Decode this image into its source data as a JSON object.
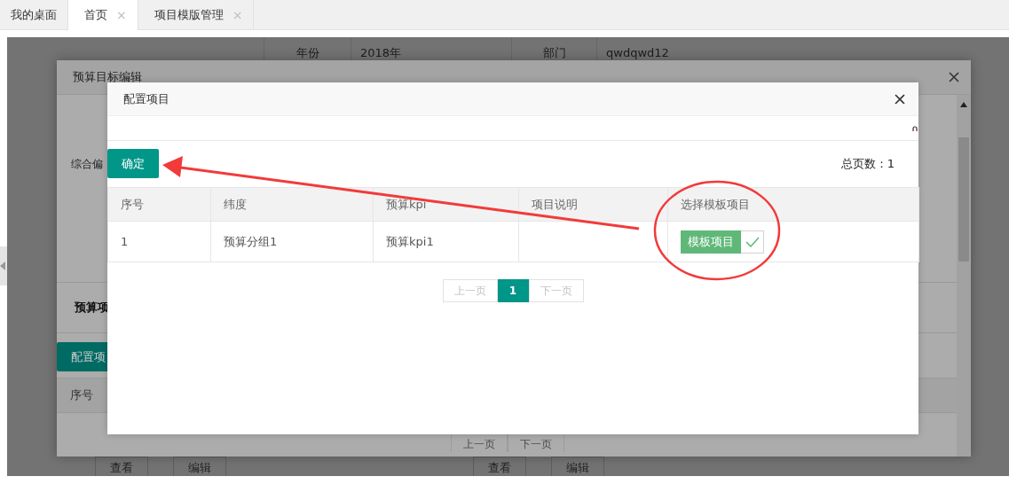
{
  "tabs": [
    {
      "label": "我的桌面",
      "selected": false
    },
    {
      "label": "首页",
      "selected": true,
      "close": "×"
    },
    {
      "label": "项目模版管理",
      "selected": false,
      "close": "×"
    }
  ],
  "background_page": {
    "top_row": [
      {
        "label": "年份",
        "value": "2018年"
      },
      {
        "label": "部门",
        "value": "qwdqwd12"
      }
    ],
    "bottom_actions": [
      [
        "查看",
        "编辑"
      ],
      [
        "查看",
        "编辑"
      ]
    ]
  },
  "edit_dialog": {
    "title": "预算目标编辑",
    "field_label": "综合偏",
    "section_title": "预算项",
    "config_button": "配置项",
    "table_columns": [
      "序号"
    ],
    "pagination": {
      "prev": "上一页",
      "next": "下一页"
    }
  },
  "config_dialog": {
    "title": "配置项目",
    "confirm_button": "确定",
    "total_pages": "总页数：1",
    "columns": [
      "序号",
      "纬度",
      "预算kpi",
      "项目说明",
      "选择模板项目"
    ],
    "rows": [
      {
        "index": "1",
        "dimension": "预算分组1",
        "kpi": "预算kpi1",
        "template": {
          "label": "模板项目",
          "checked": true
        }
      }
    ],
    "pagination": {
      "prev": "上一页",
      "pages": [
        {
          "label": "1",
          "selected": true
        }
      ],
      "next": "下一页"
    }
  }
}
